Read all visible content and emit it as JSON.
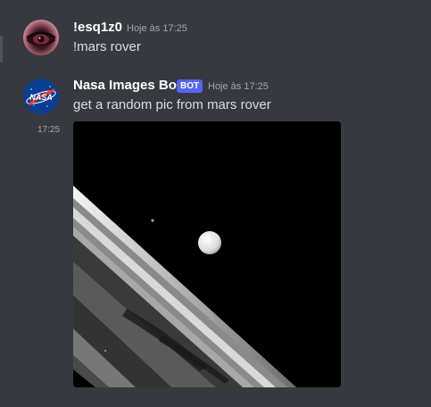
{
  "messages": [
    {
      "username": "!esq1z0",
      "timestamp": "Hoje às 17:25",
      "content": "!mars rover"
    },
    {
      "username": "Nasa Images Bot",
      "bot_tag": "BOT",
      "timestamp": "Hoje às 17:25",
      "content": "get a random pic from mars rover",
      "side_timestamp": "17:25",
      "avatar_text": "NASA"
    }
  ],
  "colors": {
    "background": "#36393f",
    "username": "#ffffff",
    "bot_tag": "#5865f2",
    "text": "#dcddde",
    "muted": "#a3a6aa"
  }
}
